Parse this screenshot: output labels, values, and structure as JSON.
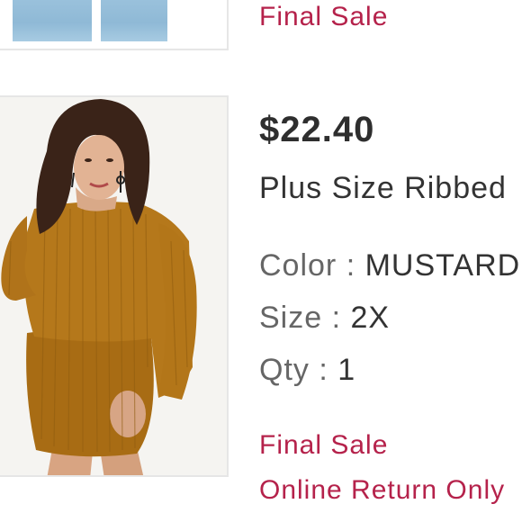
{
  "previous_item": {
    "badge": "Final Sale"
  },
  "item": {
    "price": "$22.40",
    "title": "Plus Size Ribbed",
    "color": {
      "label": "Color",
      "separator": ":",
      "value": "MUSTARD"
    },
    "size": {
      "label": "Size",
      "separator": ":",
      "value": "2X"
    },
    "qty": {
      "label": "Qty",
      "separator": ":",
      "value": "1"
    },
    "badges": [
      "Final Sale",
      "Online Return Only"
    ]
  },
  "colors": {
    "sale_red": "#b5224b",
    "text_dark": "#2e2e2e",
    "text_gray": "#666666",
    "border": "#e6e6e6",
    "mustard": "#b07419"
  },
  "icons": {
    "product_image": "product-photo-mustard-ribbed-dress"
  }
}
